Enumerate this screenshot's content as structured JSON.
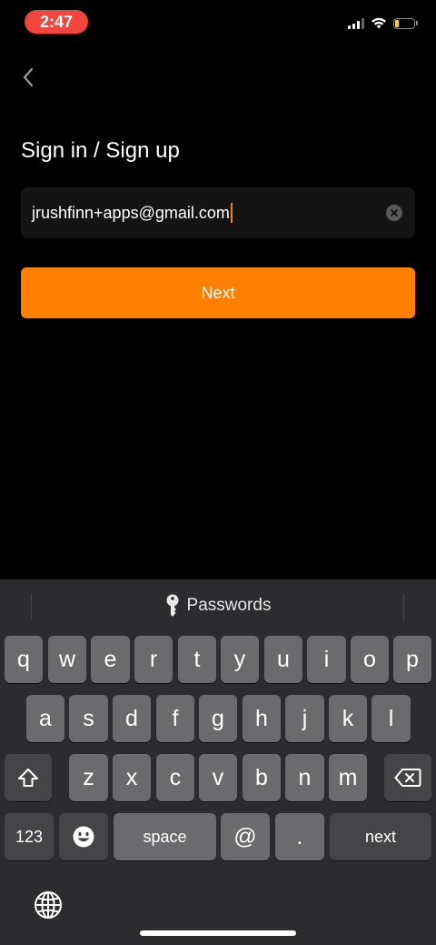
{
  "status_bar": {
    "time": "2:47",
    "signal_bars": 3,
    "battery_level": 0.15,
    "battery_color": "#ffd60a"
  },
  "nav": {
    "back_icon": "chevron-left-icon"
  },
  "title": "Sign in / Sign up",
  "email_field": {
    "value": "jrushfinn+apps@gmail.com",
    "clear_icon": "clear-icon"
  },
  "next_button": {
    "label": "Next",
    "color": "#ff8000"
  },
  "keyboard": {
    "suggestion": {
      "icon": "key-icon",
      "label": "Passwords"
    },
    "row1": [
      "q",
      "w",
      "e",
      "r",
      "t",
      "y",
      "u",
      "i",
      "o",
      "p"
    ],
    "row2": [
      "a",
      "s",
      "d",
      "f",
      "g",
      "h",
      "j",
      "k",
      "l"
    ],
    "row3": [
      "z",
      "x",
      "c",
      "v",
      "b",
      "n",
      "m"
    ],
    "shift_icon": "shift-icon",
    "delete_icon": "backspace-icon",
    "numbers_label": "123",
    "emoji_icon": "emoji-icon",
    "space_label": "space",
    "at_label": "@",
    "dot_label": ".",
    "return_label": "next",
    "globe_icon": "globe-icon"
  }
}
